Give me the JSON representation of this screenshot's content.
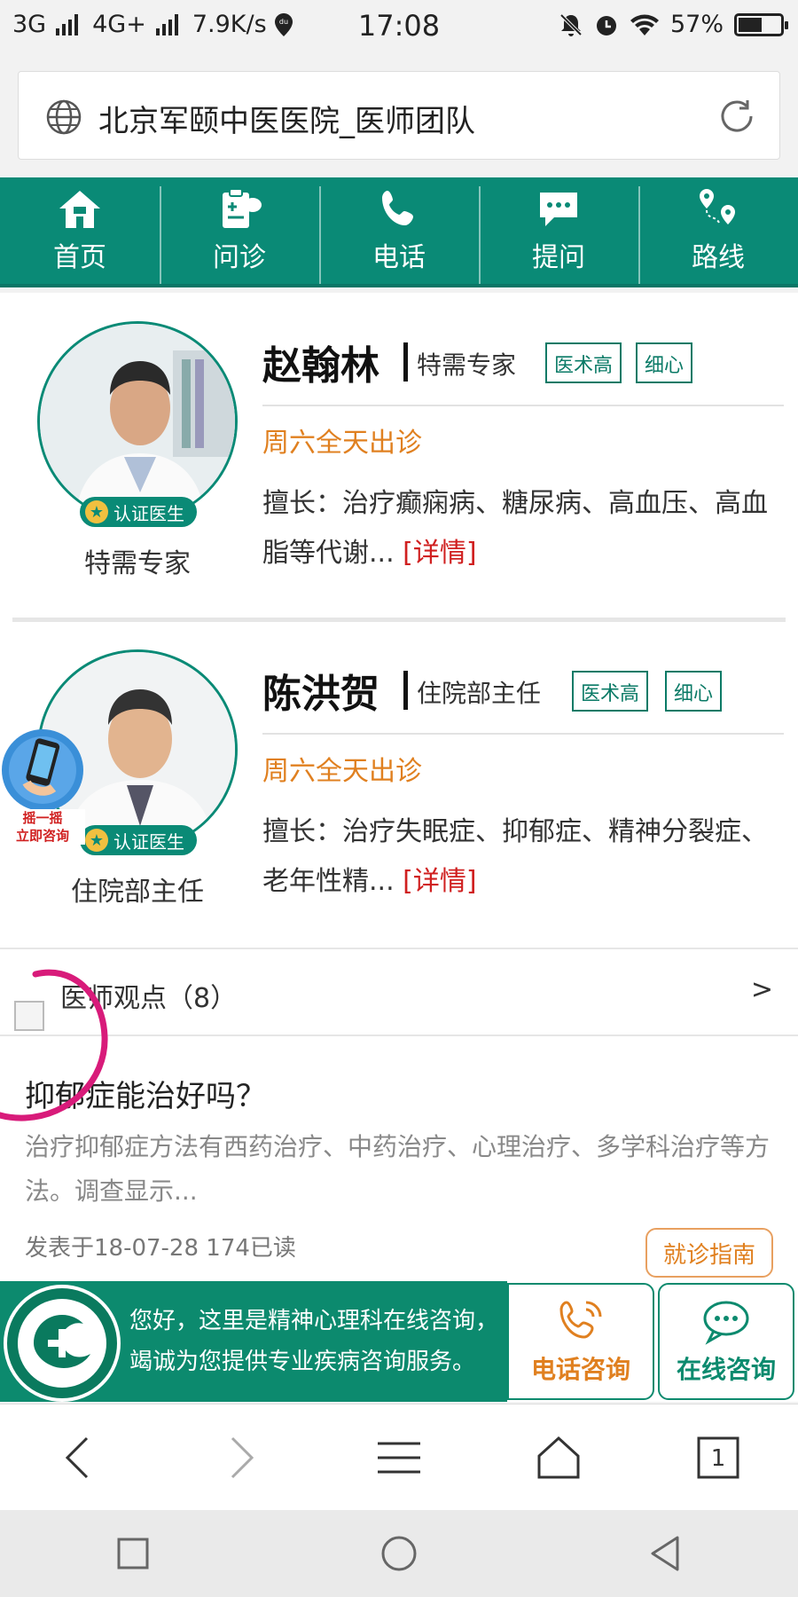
{
  "status_bar": {
    "network_left": "3G",
    "network_right": "4G+",
    "speed": "7.9K/s",
    "time": "17:08",
    "battery": "57%",
    "battery_level": 0.57
  },
  "address_bar": {
    "title": "北京军颐中医医院_医师团队"
  },
  "nav": [
    {
      "label": "首页",
      "icon": "home-icon"
    },
    {
      "label": "问诊",
      "icon": "consult-icon"
    },
    {
      "label": "电话",
      "icon": "phone-icon"
    },
    {
      "label": "提问",
      "icon": "chat-icon"
    },
    {
      "label": "路线",
      "icon": "route-icon"
    }
  ],
  "doctors": [
    {
      "name": "赵翰林",
      "title": "特需专家",
      "tags": [
        "医术高",
        "细心"
      ],
      "schedule": "周六全天出诊",
      "specialty": "擅长：治疗癫痫病、糖尿病、高血压、高血脂等代谢...",
      "detail_link": "[详情]",
      "badge": "认证医生",
      "role": "特需专家"
    },
    {
      "name": "陈洪贺",
      "title": "住院部主任",
      "tags": [
        "医术高",
        "细心"
      ],
      "schedule": "周六全天出诊",
      "specialty": "擅长：治疗失眠症、抑郁症、精神分裂症、老年性精...",
      "detail_link": "[详情]",
      "badge": "认证医生",
      "role": "住院部主任"
    }
  ],
  "shake_float": {
    "line1": "摇一摇",
    "line2": "立即咨询"
  },
  "viewpoints": {
    "title": "医师观点（8）",
    "arrow": ">"
  },
  "article": {
    "title": "抑郁症能治好吗？",
    "summary": "治疗抑郁症方法有西药治疗、中药治疗、心理治疗、多学科治疗等方法。调查显示...",
    "meta": "发表于18-07-28  174已读"
  },
  "guide_button": "就诊指南",
  "consult_bar": {
    "line1": "您好，这里是精神心理科在线咨询，",
    "line2": "竭诚为您提供专业疾病咨询服务。",
    "phone_label": "电话咨询",
    "online_label": "在线咨询"
  },
  "browser_toolbar": {
    "tab_count": "1"
  },
  "colors": {
    "brand_green": "#0a8a76",
    "accent_orange": "#e08020",
    "link_red": "#d02020"
  }
}
